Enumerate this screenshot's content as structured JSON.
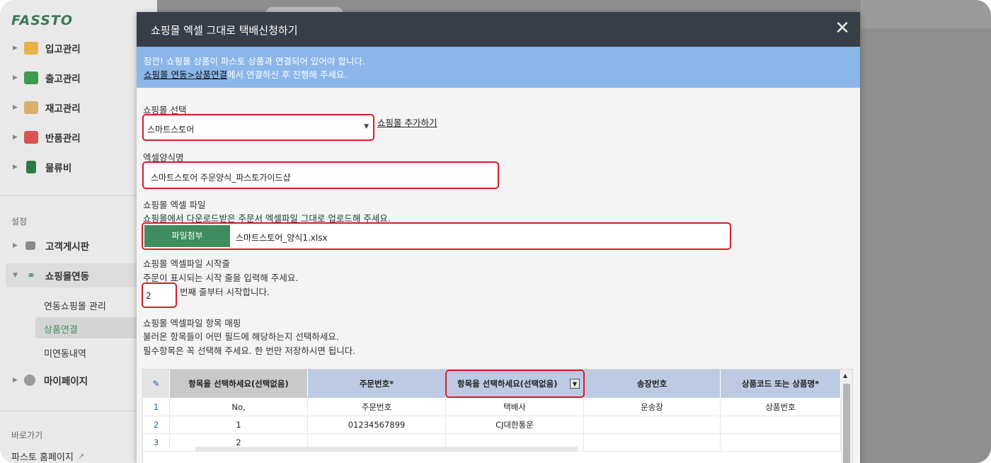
{
  "sidebar": {
    "logo": "FASSTO",
    "items": [
      {
        "label": "입고관리"
      },
      {
        "label": "출고관리"
      },
      {
        "label": "재고관리"
      },
      {
        "label": "반품관리"
      },
      {
        "label": "물류비"
      }
    ],
    "settings_label": "설정",
    "settings_items": [
      {
        "label": "고객게시판"
      },
      {
        "label": "쇼핑몰연동"
      }
    ],
    "sub_items": [
      {
        "label": "연동쇼핑몰 관리"
      },
      {
        "label": "상품연결"
      },
      {
        "label": "미연동내역"
      }
    ],
    "mypage": "마이페이지",
    "shortcut_label": "바로가기",
    "shortcut_item": "파스토 홈페이지"
  },
  "modal": {
    "title": "쇼핑몰 엑셀 그대로 택배신청하기",
    "close": "✕",
    "notice_line1": "잠깐! 쇼핑몰 상품이 파스토 상품과 연결되어 있어야 합니다.",
    "notice_link": "쇼핑몰 연동>상품연결",
    "notice_line2_rest": "에서 연결하신 후 진행해 주세요.",
    "shop_select_label": "쇼핑몰 선택",
    "shop_select_value": "스마트스토어",
    "add_shop_link": "쇼핑몰 추가하기",
    "excel_form_label": "엑셀양식명",
    "excel_form_value": "스마트스토어 주문양식_파스토가이드샵",
    "excel_file_label": "쇼핑몰 엑셀 파일",
    "excel_file_desc": "쇼핑몰에서 다운로드받은 주문서 엑셀파일 그대로 업로드해 주세요.",
    "file_button": "파일첨부",
    "file_name": "스마트스토어_양식1.xlsx",
    "start_row_label": "쇼핑몰 엑셀파일 시작줄",
    "start_row_desc": "주문이 표시되는 시작 줄을 입력해 주세요.",
    "start_row_value": "2",
    "start_row_suffix": "번째 줄부터 시작합니다.",
    "mapping_label": "쇼핑몰 엑셀파일 항목 매핑",
    "mapping_desc1": "불러온 항목들이 어떤 필드에 해당하는지 선택하세요.",
    "mapping_desc2": "필수항목은 꼭 선택해 주세요. 한 번만 저장하시면 됩니다."
  },
  "table": {
    "headers": [
      "항목을 선택하세요(선택없음)",
      "주문번호*",
      "항목을 선택하세요(선택없음)",
      "송장번호",
      "상품코드 또는 상품명*"
    ],
    "rows": [
      {
        "num": "1",
        "cells": [
          "No,",
          "주문번호",
          "택배사",
          "운송장",
          "상품번호"
        ]
      },
      {
        "num": "2",
        "cells": [
          "1",
          "01234567899",
          "CJ대한통운",
          "",
          ""
        ]
      },
      {
        "num": "3",
        "cells": [
          "2",
          "",
          "",
          "",
          ""
        ]
      }
    ]
  },
  "colors": {
    "accent_green": "#3f8d5e",
    "notice_blue": "#8bb6ea",
    "highlight_red": "#d91c2a",
    "header_dark": "#383e48"
  }
}
